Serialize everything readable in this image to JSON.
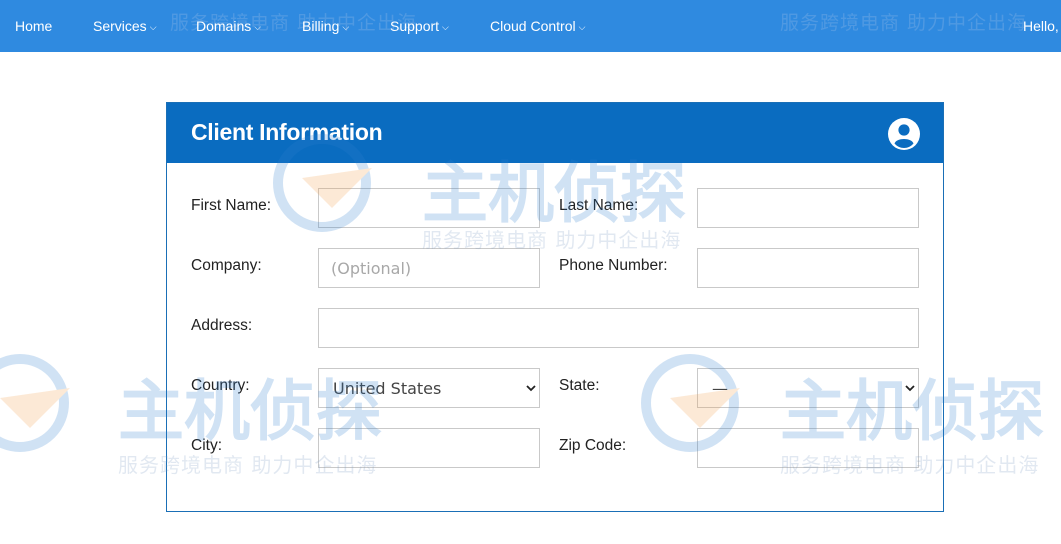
{
  "nav": {
    "home": "Home",
    "services": "Services",
    "domains": "Domains",
    "billing": "Billing",
    "support": "Support",
    "cloud_control": "Cloud Control",
    "hello": "Hello,"
  },
  "card": {
    "title": "Client Information",
    "icon": "user-circle-icon"
  },
  "form": {
    "first_name_label": "First Name:",
    "first_name_value": "",
    "last_name_label": "Last Name:",
    "last_name_value": "",
    "company_label": "Company:",
    "company_placeholder": "(Optional)",
    "phone_label": "Phone Number:",
    "phone_value": "",
    "address_label": "Address:",
    "address_value": "",
    "country_label": "Country:",
    "country_selected": "United States",
    "state_label": "State:",
    "state_selected": "—",
    "city_label": "City:",
    "city_value": "",
    "zip_label": "Zip Code:",
    "zip_value": ""
  },
  "watermark": {
    "brand": "主机侦探",
    "slogan": "服务跨境电商 助力中企出海"
  },
  "colors": {
    "nav_bg": "#2f8ae0",
    "header_bg": "#0a6cc0",
    "border": "#1a6fb6"
  }
}
